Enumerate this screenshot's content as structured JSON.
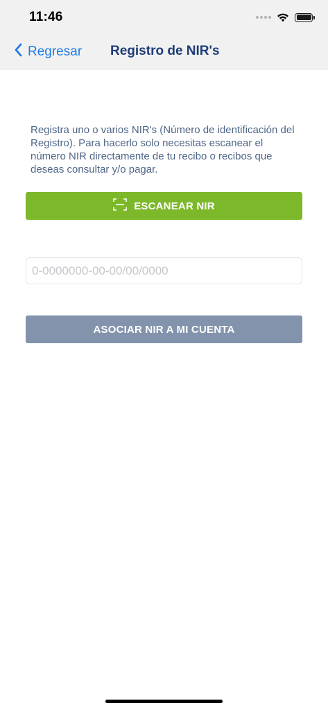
{
  "status_bar": {
    "time": "11:46",
    "icons": [
      "signal-dots-icon",
      "wifi-icon",
      "battery-icon"
    ]
  },
  "nav": {
    "back_label": "Regresar",
    "title": "Registro de NIR's"
  },
  "content": {
    "description": "Registra uno o varios NIR's (Número de identificación del Registro). Para hacerlo solo necesitas escanear el número NIR directamente de tu recibo o recibos que deseas consultar y/o pagar.",
    "scan_button_label": "ESCANEAR NIR",
    "nir_input": {
      "placeholder": "0-0000000-00-00/00/0000",
      "value": ""
    },
    "associate_button_label": "ASOCIAR NIR A MI CUENTA"
  },
  "colors": {
    "accent_blue": "#1f7be6",
    "title_navy": "#1f3c78",
    "scan_green": "#7cb82a",
    "disabled_slate": "#8293ab",
    "text_slate": "#4e6687"
  }
}
